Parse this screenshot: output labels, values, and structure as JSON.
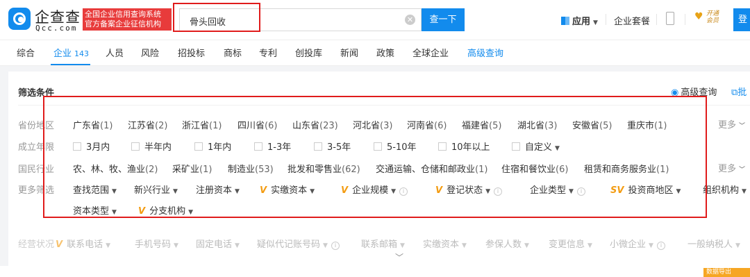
{
  "header": {
    "logo_text": "企查查",
    "logo_domain": "Qcc.com",
    "badge_line1": "全国企业信用查询系统",
    "badge_line2": "官方备案企业征信机构",
    "search_value": "骨头回收",
    "search_button": "查一下",
    "app_menu": "应用",
    "package_link": "企业套餐",
    "vip_line1": "开通",
    "vip_line2": "会员",
    "login": "登"
  },
  "tabs": [
    {
      "label": "综合"
    },
    {
      "label": "企业",
      "count": "143",
      "active": true
    },
    {
      "label": "人员"
    },
    {
      "label": "风险"
    },
    {
      "label": "招投标"
    },
    {
      "label": "商标"
    },
    {
      "label": "专利"
    },
    {
      "label": "创投库"
    },
    {
      "label": "新闻"
    },
    {
      "label": "政策"
    },
    {
      "label": "全球企业"
    },
    {
      "label": "高级查询"
    }
  ],
  "filters": {
    "title": "筛选条件",
    "advanced_query": "高级查询",
    "batch": "批",
    "more": "更多",
    "rows": {
      "province": {
        "label": "省份地区",
        "options": [
          {
            "name": "广东省",
            "count": "(1)"
          },
          {
            "name": "江苏省",
            "count": "(2)"
          },
          {
            "name": "浙江省",
            "count": "(1)"
          },
          {
            "name": "四川省",
            "count": "(6)"
          },
          {
            "name": "山东省",
            "count": "(23)"
          },
          {
            "name": "河北省",
            "count": "(3)"
          },
          {
            "name": "河南省",
            "count": "(6)"
          },
          {
            "name": "福建省",
            "count": "(5)"
          },
          {
            "name": "湖北省",
            "count": "(3)"
          },
          {
            "name": "安徽省",
            "count": "(5)"
          },
          {
            "name": "重庆市",
            "count": "(1)"
          }
        ]
      },
      "established": {
        "label": "成立年限",
        "options": [
          "3月内",
          "半年内",
          "1年内",
          "1-3年",
          "3-5年",
          "5-10年",
          "10年以上",
          "自定义"
        ]
      },
      "industry": {
        "label": "国民行业",
        "options": [
          {
            "name": "农、林、牧、渔业",
            "count": "(2)"
          },
          {
            "name": "采矿业",
            "count": "(1)"
          },
          {
            "name": "制造业",
            "count": "(53)"
          },
          {
            "name": "批发和零售业",
            "count": "(62)"
          },
          {
            "name": "交通运输、仓储和邮政业",
            "count": "(1)"
          },
          {
            "name": "住宿和餐饮业",
            "count": "(6)"
          },
          {
            "name": "租赁和商务服务业",
            "count": "(1)"
          }
        ]
      },
      "more_filters": {
        "label": "更多筛选",
        "options": [
          "查找范围",
          "新兴行业",
          "注册资本",
          "实缴资本",
          "企业规模",
          "登记状态",
          "企业类型",
          "投资商地区",
          "组织机构",
          "资本类型",
          "分支机构"
        ]
      },
      "business": {
        "label": "经营状况",
        "options": [
          "联系电话",
          "手机号码",
          "固定电话",
          "疑似代记账号码",
          "联系邮箱",
          "实缴资本",
          "参保人数",
          "变更信息",
          "小微企业",
          "一般纳税人"
        ]
      }
    }
  },
  "export_badge": "数据导出",
  "colors": {
    "accent": "#128bed",
    "highlight_frame": "#e01b1b",
    "badge_red": "#e83b3b",
    "vip_orange": "#f39c12"
  }
}
